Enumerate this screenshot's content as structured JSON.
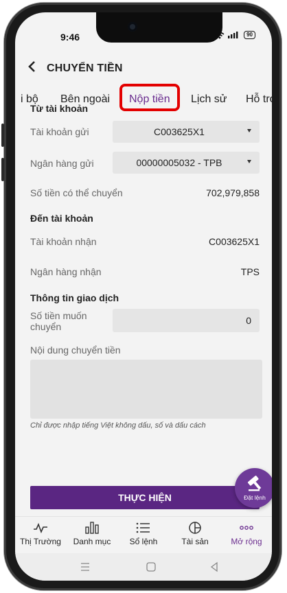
{
  "status": {
    "time": "9:46",
    "battery": "90"
  },
  "header": {
    "title": "CHUYỂN TIỀN"
  },
  "tabs": [
    {
      "label": "i bộ"
    },
    {
      "label": "Bên ngoài"
    },
    {
      "label": "Nộp tiền"
    },
    {
      "label": "Lịch sử"
    },
    {
      "label": "Hỗ trợ"
    }
  ],
  "from_section": {
    "title": "Từ tài khoản",
    "source_account_label": "Tài khoản gửi",
    "source_account_value": "C003625X1",
    "source_bank_label": "Ngân hàng gửi",
    "source_bank_value": "00000005032 - TPB",
    "available_label": "Số tiền có thể chuyển",
    "available_value": "702,979,858"
  },
  "to_section": {
    "title": "Đến tài khoản",
    "receive_account_label": "Tài khoản nhận",
    "receive_account_value": "C003625X1",
    "receive_bank_label": "Ngân hàng nhận",
    "receive_bank_value": "TPS"
  },
  "transaction": {
    "title": "Thông tin giao dịch",
    "amount_label": "Số tiền muốn chuyển",
    "amount_value": "0",
    "content_label": "Nội dung chuyển tiền",
    "content_value": "",
    "hint": "Chỉ được nhập tiếng Việt không dấu, số và dấu cách"
  },
  "submit_label": "THỰC HIỆN",
  "fab_label": "Đặt lệnh",
  "bottom_nav": [
    {
      "label": "Thị Trường",
      "icon": "market-chart-icon"
    },
    {
      "label": "Danh mục",
      "icon": "bar-chart-icon"
    },
    {
      "label": "Sổ lệnh",
      "icon": "list-icon"
    },
    {
      "label": "Tài sản",
      "icon": "pie-chart-icon"
    },
    {
      "label": "Mở rộng",
      "icon": "more-dots-icon"
    }
  ],
  "colors": {
    "accent": "#6a2c8e",
    "highlight": "#e30000",
    "button": "#5a2682"
  }
}
